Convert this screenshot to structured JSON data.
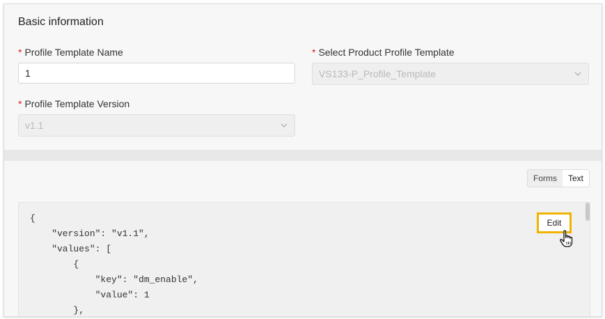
{
  "section": {
    "title": "Basic information"
  },
  "fields": {
    "profile_template_name": {
      "required_mark": "*",
      "label": "Profile Template Name",
      "value": "1"
    },
    "product_profile_template": {
      "required_mark": "*",
      "label": "Select Product Profile Template",
      "value": "VS133-P_Profile_Template"
    },
    "profile_template_version": {
      "required_mark": "*",
      "label": "Profile Template Version",
      "value": "v1.1"
    }
  },
  "view_tabs": {
    "forms": "Forms",
    "text": "Text",
    "selected": "Text"
  },
  "editor": {
    "edit_label": "Edit",
    "lines": [
      "{",
      "    \"version\": \"v1.1\",",
      "    \"values\": [",
      "        {",
      "            \"key\": \"dm_enable\",",
      "            \"value\": 1",
      "        },"
    ]
  },
  "colors": {
    "required": "#e02020",
    "highlight": "#f0b400"
  },
  "icons": {
    "select_chevron": "chevron-down-icon",
    "pointer": "hand-pointer-icon"
  }
}
